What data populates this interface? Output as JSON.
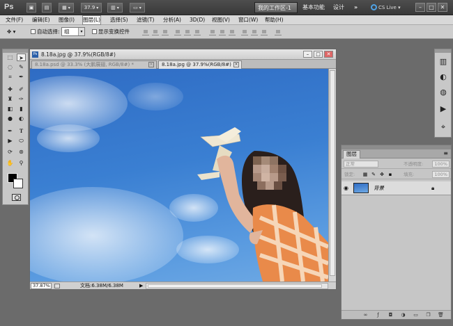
{
  "appbar": {
    "logo": "Ps",
    "zoom_value": "37.9",
    "workspaces": {
      "active": "我的工作区-1",
      "basic": "基本功能",
      "design": "设计",
      "more": "»"
    },
    "cs_live": "CS Live"
  },
  "menubar": {
    "items": [
      "文件(F)",
      "编辑(E)",
      "图像(I)",
      "图层(L)",
      "选择(S)",
      "滤镜(T)",
      "分析(A)",
      "3D(D)",
      "视图(V)",
      "窗口(W)",
      "帮助(H)"
    ],
    "active_index": 3
  },
  "options": {
    "auto_select_label": "自动选择:",
    "auto_select_value": "组",
    "show_transform_label": "显示变换控件"
  },
  "document": {
    "title": "8.18a.jpg @ 37.9%(RGB/8#)",
    "tabs": [
      {
        "label": "8.18a.psd @ 33.3% (大鹏展翅, RGB/8#) *"
      },
      {
        "label": "8.18a.jpg @ 37.9%(RGB/8#)"
      }
    ],
    "status": {
      "zoom": "37.87%",
      "doc_info": "文档:6.38M/6.38M"
    }
  },
  "layers_panel": {
    "tab_label": "图层",
    "blend_mode": "正常",
    "opacity_label": "不透明度:",
    "opacity_value": "100%",
    "lock_label": "锁定:",
    "fill_label": "填充:",
    "fill_value": "100%",
    "layer_name": "背景"
  },
  "colors": {
    "foreground": "#000000",
    "background": "#ffffff",
    "sky_top": "#2f6cc4",
    "sky_bottom": "#6ea9e4"
  }
}
